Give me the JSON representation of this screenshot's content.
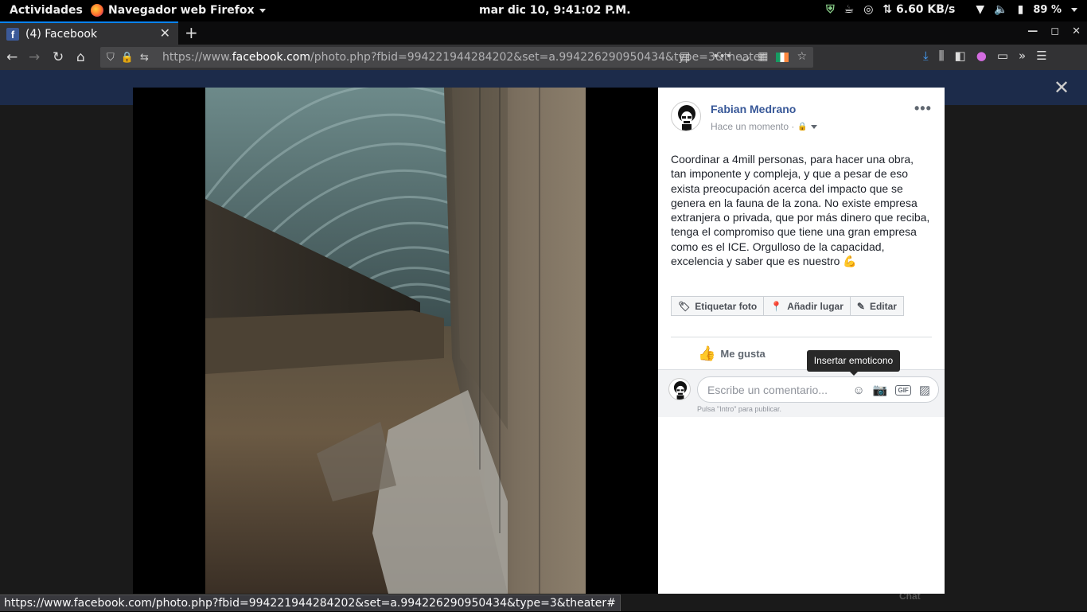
{
  "topbar": {
    "activities": "Actividades",
    "app_name": "Navegador web Firefox",
    "clock": "mar dic 10,  9:41:02 P.M.",
    "network_speed": "⇅ 6.60 KB/s",
    "battery": "89 %"
  },
  "tab": {
    "title": "(4) Facebook",
    "favicon_letter": "f"
  },
  "urlbar": {
    "prefix": "https://www.",
    "domain": "facebook.com",
    "path": "/photo.php?fbid=994221944284202&set=a.994226290950434&type=3&theater"
  },
  "post": {
    "author": "Fabian Medrano",
    "time": "Hace un momento ·",
    "text": "Coordinar a 4mill personas, para hacer una obra, tan imponente y compleja, y que a pesar de eso exista preocupación acerca del impacto que se genera en la fauna de la zona. No existe empresa extranjera o privada, que por más dinero que reciba, tenga el compromiso que tiene una gran empresa como es el ICE. Orgulloso de la capacidad, excelencia y saber que es nuestro 💪",
    "actions": {
      "tag": "Etiquetar foto",
      "place": "Añadir lugar",
      "edit": "Editar"
    },
    "like_label": "Me gusta",
    "comment_placeholder": "Escribe un comentario...",
    "comment_hint": "Pulsa \"Intro\" para publicar.",
    "tooltip": "Insertar emoticono"
  },
  "statusbar": {
    "url": "https://www.facebook.com/photo.php?fbid=994221944284202&set=a.994226290950434&type=3&theater#"
  },
  "background": {
    "chat_label": "Chat"
  },
  "colors": {
    "fb_blue": "#385898",
    "firefox_accent": "#0a84ff"
  }
}
